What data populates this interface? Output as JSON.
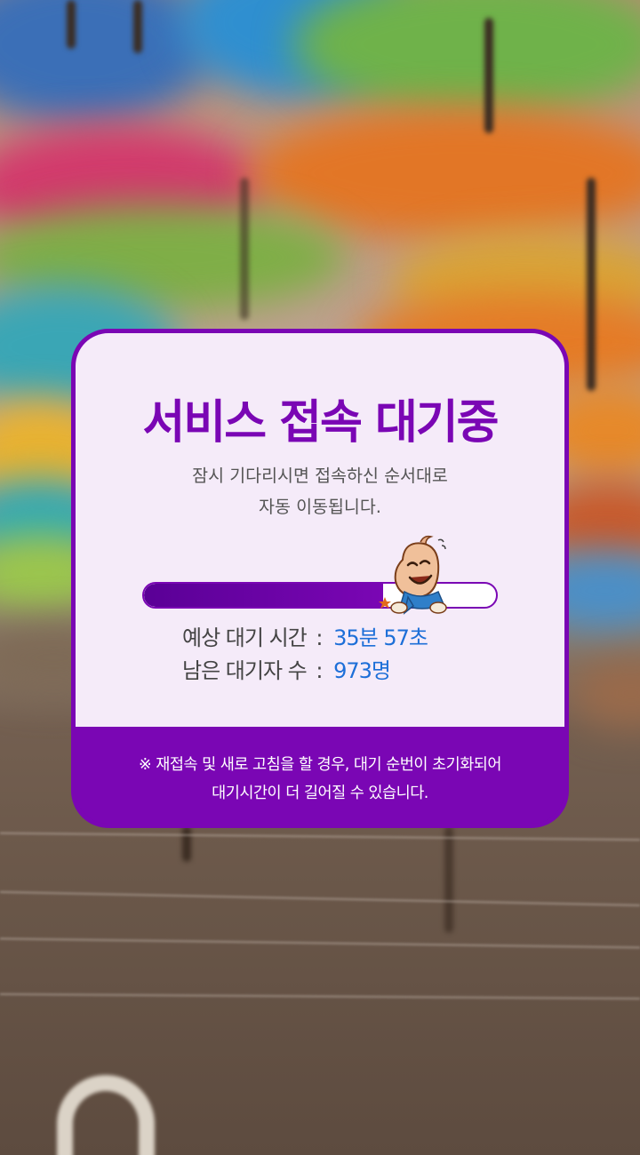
{
  "dialog": {
    "title": "서비스 접속 대기중",
    "subtitle_lines": [
      "잠시 기다리시면 접속하신 순서대로",
      "자동 이동됩니다."
    ],
    "progress": 0.68,
    "wait_time": {
      "label": "예상 대기 시간",
      "separator": ":",
      "value": "35분 57초"
    },
    "queue": {
      "label": "남은 대기자 수",
      "separator": ":",
      "value": "973명"
    },
    "notice_lines": [
      "※ 재접속 및 새로 고침을 할 경우, 대기 순번이 초기화되어",
      "대기시간이 더 길어질 수 있습니다."
    ]
  },
  "colors": {
    "brand": "#7a06b4",
    "value": "#1d6fd8"
  },
  "icons": {
    "mascot": "mascot-character-icon"
  }
}
